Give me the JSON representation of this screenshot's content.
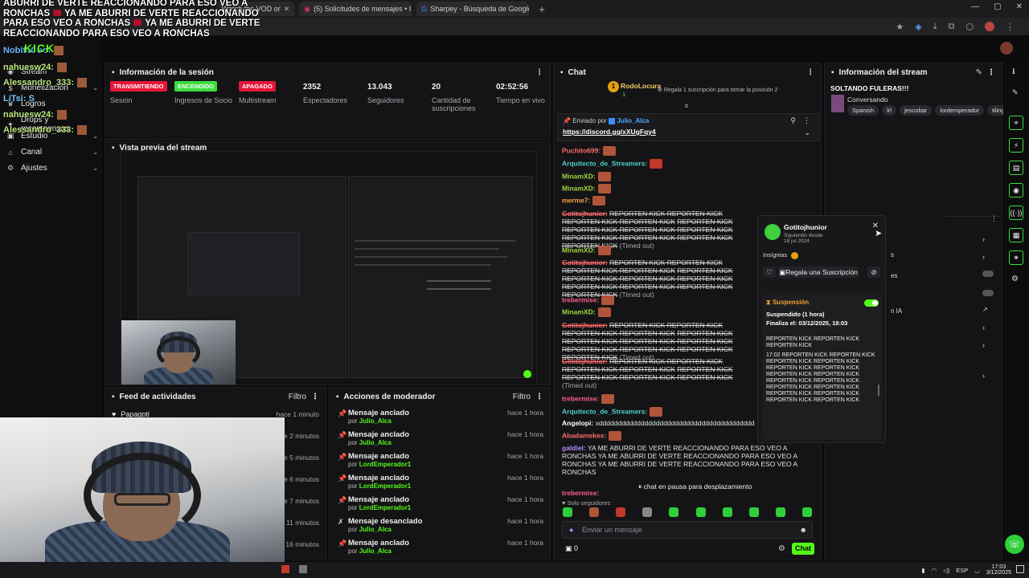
{
  "browser": {
    "tabs": [
      {
        "label": "Watch the VOD or"
      },
      {
        "label": "(5) Solicitudes de mensajes • I"
      },
      {
        "label": "Sharpey - Búsqueda de Google"
      }
    ],
    "new_tab": "+"
  },
  "overlay_chat": {
    "line1": "ABURRI DE VERTE REACCIONANDO PARA ESO VEO A",
    "line2": "RONCHAS",
    "line2b": "YA ME ABURRI DE VERTE REACCIONANDO",
    "line3": "PARA ESO VEO A RONCHAS",
    "line3b": "YA ME ABURRI DE VERTE",
    "line4": "REACCIONANDO PARA ESO VEO A RONCHAS"
  },
  "sidebar_overlay": {
    "u1": "NobitaCool",
    "u2": "nahuesw24:",
    "u3": "Alessandro_333:",
    "u4": "LiTsi: S",
    "u5": "nahuesw24:",
    "u6": "Alessandro_333:",
    "kick": "KICK"
  },
  "sidebar": {
    "items": [
      {
        "label": "Stream"
      },
      {
        "label": "Monetización"
      },
      {
        "label": "Logros"
      },
      {
        "label": "Drops y recompensas"
      },
      {
        "label": "Estudio"
      },
      {
        "label": "Canal"
      },
      {
        "label": "Ajustes"
      }
    ]
  },
  "session": {
    "title": "Información de la sesión",
    "blocks": [
      {
        "badge": "TRANSMITIENDO",
        "label": "Sesión"
      },
      {
        "badge": "ENCENDIDO",
        "label": "Ingresos de Socio"
      },
      {
        "badge": "APAGADO",
        "label": "Multistream"
      },
      {
        "value": "2352",
        "label": "Espectadores"
      },
      {
        "value": "13.043",
        "label": "Seguidores"
      },
      {
        "value": "20",
        "label": "Cantidad de suscripciones"
      },
      {
        "value": "02:52:56",
        "label": "Tiempo en vivo"
      }
    ]
  },
  "preview": {
    "title": "Vista previa del stream"
  },
  "activity": {
    "title": "Feed de actividades",
    "filter": "Filtro",
    "rows": [
      {
        "user": "Papagoti",
        "time": "hace 1 minuto"
      },
      {
        "user": "",
        "time": "hace 2 minutos"
      },
      {
        "user": "",
        "time": "hace 5 minutos"
      },
      {
        "user": "",
        "time": "hace 6 minutos"
      },
      {
        "user": "",
        "time": "hace 7 minutos"
      },
      {
        "user": "",
        "time": "hace 11 minutos"
      },
      {
        "user": "",
        "time": "hace 16 minutos"
      }
    ]
  },
  "moderator": {
    "title": "Acciones de moderador",
    "filter": "Filtro",
    "by_prefix": "por",
    "rows": [
      {
        "action": "Mensaje anclado",
        "by": "Julio_Alca",
        "time": "hace 1 hora"
      },
      {
        "action": "Mensaje anclado",
        "by": "Julio_Alca",
        "time": "hace 1 hora"
      },
      {
        "action": "Mensaje anclado",
        "by": "LordEmperador1",
        "time": "hace 1 hora"
      },
      {
        "action": "Mensaje anclado",
        "by": "LordEmperador1",
        "time": "hace 1 hora"
      },
      {
        "action": "Mensaje anclado",
        "by": "LordEmperador1",
        "time": "hace 1 hora"
      },
      {
        "action": "Mensaje desanclado",
        "by": "Julio_Alca",
        "time": "hace 1 hora"
      },
      {
        "action": "Mensaje anclado",
        "by": "Julio_Alca",
        "time": "hace 1 hora"
      }
    ]
  },
  "chat": {
    "title": "Chat",
    "top_gifter": "RodoLocura",
    "top_gifter_count": "1",
    "gift_prompt": "Regala 1 suscripción para tomar la posición 2",
    "pinned_prefix": "Enviado por",
    "pinned_user": "Julio_Alca",
    "pinned_link": "https://discord.gg/xXUgFqy4",
    "spam": "REPORTEN KICK REPORTEN KICK REPORTEN KICK REPORTEN KICK",
    "timed_out": "(Timed out)",
    "usernames": {
      "u1": "Puchito699:",
      "u2": "Arquitecto_de_Streamers:",
      "u3": "MinamXD:",
      "u4": "MinamXD:",
      "u5": "merme7:",
      "u6": "Gotitojhunior:",
      "u7": "MinamXD:",
      "u8": "Gotitojhunior:",
      "u9": "trebermise:",
      "u10": "MinamXD:",
      "u11": "Gotitojhunior:",
      "u12": "Gotitojhunior:",
      "u13": "trebermise:",
      "u14": "Arquitecto_de_Streamers:",
      "u15": "Angelopi:",
      "u16": "Abadamekes:",
      "u17": "galdiel:",
      "u18": "trebermise:"
    },
    "long_d": "xddddddddddddddddddddddddddddddddddddddddddd",
    "galdiel_msg": "YA ME ABURRI DE VERTE REACCIONANDO PARA ESO VEO A RONCHAS",
    "paused": "chat en pausa para desplazamiento",
    "mode": "Solo seguidores",
    "input_placeholder": "Enviar un mensaje",
    "points": "0",
    "send": "Chat"
  },
  "user_card": {
    "name": "Gotitojhunior",
    "following_since": "Siguiendo desde",
    "follow_date": "18 jul 2024",
    "badges_label": "Insígnias",
    "gift_button": "Regala una Suscripción",
    "suspension_title": "Suspensión",
    "suspended": "Suspendido (1 hora)",
    "ends": "Finaliza el: 03/12/2025, 18:03",
    "log": "REPORTEN KICK REPORTEN KICK REPORTEN KICK",
    "log_time_entry": "17:02 REPORTEN KICK REPORTEN KICK REPORTEN KICK REPORTEN KICK REPORTEN KICK REPORTEN KICK REPORTEN KICK REPORTEN KICK REPORTEN KICK REPORTEN KICK REPORTEN KICK REPORTEN KICK REPORTEN KICK REPORTEN KICK REPORTEN KICK REPORTEN KICK"
  },
  "stream_info": {
    "title": "Información del stream",
    "stream_title": "SOLTANDO FULERAS!!!",
    "category": "Conversando",
    "tags": [
      "Spanish",
      "lrl",
      "jescobar",
      "lordemperador",
      "tilingamer"
    ],
    "partial_1": "s",
    "partial_2": "es",
    "partial_3": "n IA"
  },
  "taskbar": {
    "lang": "ESP",
    "time": "17:03",
    "date": "3/12/2025"
  },
  "colors": {
    "accent": "#53fc18",
    "live_red": "#e5173a"
  }
}
